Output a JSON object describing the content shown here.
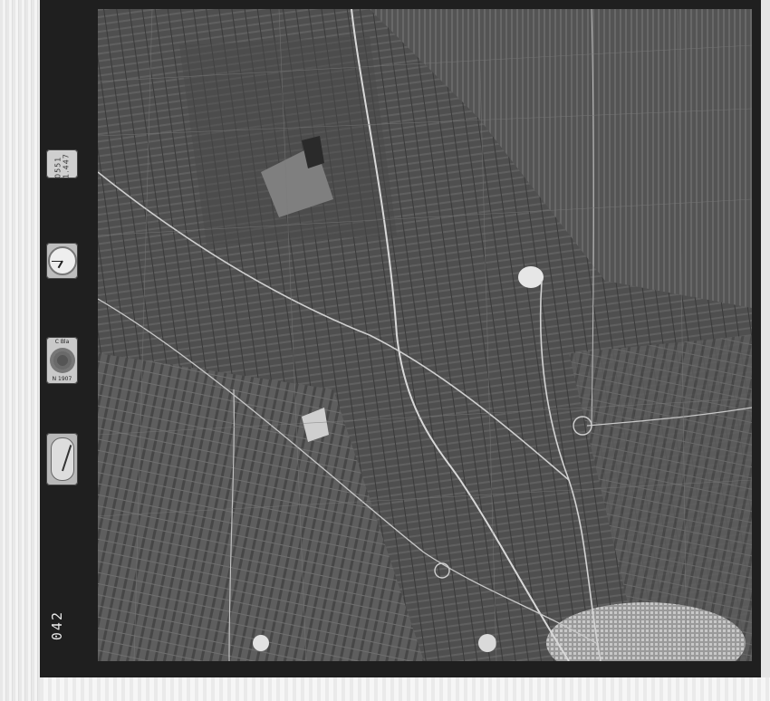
{
  "image": {
    "kind": "aerial-photograph",
    "tone": "black-and-white"
  },
  "instrument_panel": {
    "altimeter_label": "0551 1.447",
    "clock_time": "7:45",
    "level_text_top": "C Bla",
    "level_text_bottom": "N 1907",
    "frame_number": "042"
  },
  "colors": {
    "frame": "#1f1f1f",
    "paper": "#f2f2f2",
    "fields_dark": "#3e3e3e",
    "fields_light": "#8a8a8a",
    "roads": "#d8d8d8",
    "town": "#b4b4b4"
  },
  "map_features": {
    "roads": [
      "north-south main road",
      "diagonal road",
      "eastern road",
      "southern junction"
    ],
    "settlement": "town",
    "water_features": [
      "white patch",
      "reservoir"
    ]
  }
}
